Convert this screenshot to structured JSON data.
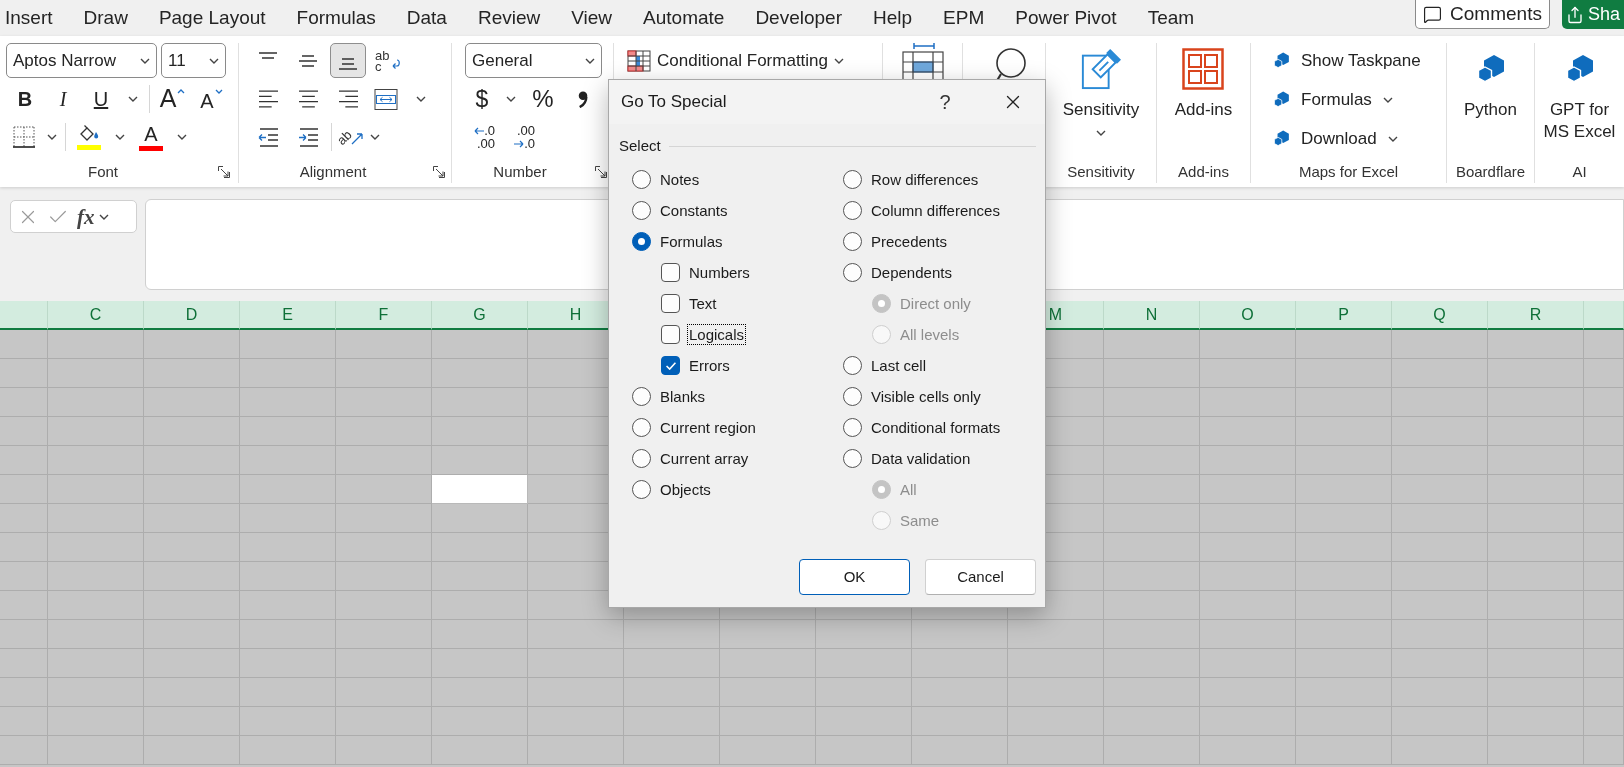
{
  "tabs": [
    "Insert",
    "Draw",
    "Page Layout",
    "Formulas",
    "Data",
    "Review",
    "View",
    "Automate",
    "Developer",
    "Help",
    "EPM",
    "Power Pivot",
    "Team"
  ],
  "header_buttons": [
    {
      "kind": "comments",
      "label": "Comments"
    },
    {
      "kind": "share",
      "label": "Sha"
    }
  ],
  "ribbon": {
    "font": {
      "label": "Font",
      "font_name": "Aptos Narrow",
      "font_size": "11",
      "style_buttons": [
        {
          "kind": "bold",
          "text": "B"
        },
        {
          "kind": "italic",
          "text": "I"
        },
        {
          "kind": "underline",
          "text": "U"
        }
      ],
      "size_buttons": [
        {
          "kind": "grow",
          "text": "A"
        },
        {
          "kind": "shrink",
          "text": "A"
        }
      ],
      "fill_color": {
        "color": "#ffff00"
      },
      "font_color": {
        "text": "A",
        "color": "#ff0000"
      }
    },
    "alignment": {
      "label": "Alignment",
      "vertical": [
        {
          "kind": "top",
          "selected": false
        },
        {
          "kind": "middle",
          "selected": false
        },
        {
          "kind": "bottom",
          "selected": true
        }
      ],
      "wrap_text": "ab c",
      "orientation": "ab"
    },
    "number": {
      "label": "Number",
      "format": "General",
      "currency": "$",
      "percent": "%",
      "increase_decimal": [
        ".0",
        ".00"
      ],
      "decrease_decimal": [
        ".00",
        ".0"
      ]
    },
    "styles": {
      "conditional_formatting": "Conditional Formatting"
    },
    "sensitivity": {
      "label": "Sensitivity",
      "button": "Sensitivity"
    },
    "add_ins": {
      "label": "Add-ins",
      "button": "Add-ins"
    },
    "maps": {
      "label": "Maps for Excel",
      "items": [
        {
          "label": "Show Taskpane",
          "dropdown": false
        },
        {
          "label": "Formulas",
          "dropdown": true
        },
        {
          "label": "Download",
          "dropdown": true
        }
      ]
    },
    "boardflare": {
      "label": "Boardflare",
      "button": "Python"
    },
    "ai": {
      "label": "AI",
      "button": "GPT for MS Excel"
    }
  },
  "formula_bar": {
    "function_label": "fx"
  },
  "sheet": {
    "all_selected": true,
    "columns_left": [
      {
        "label": "C",
        "selected": true,
        "active": false
      },
      {
        "label": "D",
        "selected": true,
        "active": false
      },
      {
        "label": "E",
        "selected": true,
        "active": false
      },
      {
        "label": "F",
        "selected": true,
        "active": false
      },
      {
        "label": "G",
        "selected": true,
        "active": true
      },
      {
        "label": "H",
        "selected": true,
        "active": false
      }
    ],
    "columns_right": [
      {
        "label": "M",
        "selected": true,
        "active": false
      },
      {
        "label": "N",
        "selected": true,
        "active": false
      },
      {
        "label": "O",
        "selected": true,
        "active": false
      },
      {
        "label": "P",
        "selected": true,
        "active": false
      },
      {
        "label": "Q",
        "selected": true,
        "active": false
      },
      {
        "label": "R",
        "selected": true,
        "active": false
      }
    ],
    "rows": [
      {
        "active": false
      },
      {
        "active": false
      },
      {
        "active": false
      },
      {
        "active": false
      },
      {
        "active": false
      },
      {
        "active": true
      },
      {
        "active": false
      },
      {
        "active": false
      },
      {
        "active": false
      },
      {
        "active": false
      },
      {
        "active": false
      },
      {
        "active": false
      },
      {
        "active": false
      },
      {
        "active": false
      },
      {
        "active": false
      }
    ]
  },
  "dialog": {
    "title": "Go To Special",
    "help": "?",
    "group_label": "Select",
    "left_options": [
      {
        "kind": "radio",
        "label": "Notes",
        "selected": false,
        "disabled": false,
        "focused": false
      },
      {
        "kind": "radio",
        "label": "Constants",
        "selected": false,
        "disabled": false,
        "focused": false
      },
      {
        "kind": "radio",
        "label": "Formulas",
        "selected": true,
        "disabled": false,
        "focused": false,
        "children": [
          {
            "kind": "checkbox",
            "label": "Numbers",
            "checked": false,
            "disabled": false,
            "focused": false
          },
          {
            "kind": "checkbox",
            "label": "Text",
            "checked": false,
            "disabled": false,
            "focused": false
          },
          {
            "kind": "checkbox",
            "label": "Logicals",
            "checked": false,
            "disabled": false,
            "focused": true
          },
          {
            "kind": "checkbox",
            "label": "Errors",
            "checked": true,
            "disabled": false,
            "focused": false
          }
        ]
      },
      {
        "kind": "radio",
        "label": "Blanks",
        "selected": false,
        "disabled": false,
        "focused": false
      },
      {
        "kind": "radio",
        "label": "Current region",
        "selected": false,
        "disabled": false,
        "focused": false
      },
      {
        "kind": "radio",
        "label": "Current array",
        "selected": false,
        "disabled": false,
        "focused": false
      },
      {
        "kind": "radio",
        "label": "Objects",
        "selected": false,
        "disabled": false,
        "focused": false
      }
    ],
    "right_options": [
      {
        "kind": "radio",
        "label": "Row differences",
        "selected": false,
        "disabled": false,
        "focused": false
      },
      {
        "kind": "radio",
        "label": "Column differences",
        "selected": false,
        "disabled": false,
        "focused": false
      },
      {
        "kind": "radio",
        "label": "Precedents",
        "selected": false,
        "disabled": false,
        "focused": false
      },
      {
        "kind": "radio",
        "label": "Dependents",
        "selected": false,
        "disabled": false,
        "focused": false,
        "children": [
          {
            "kind": "radio",
            "label": "Direct only",
            "selected": true,
            "disabled": true,
            "focused": false
          },
          {
            "kind": "radio",
            "label": "All levels",
            "selected": false,
            "disabled": true,
            "focused": false
          }
        ]
      },
      {
        "kind": "radio",
        "label": "Last cell",
        "selected": false,
        "disabled": false,
        "focused": false
      },
      {
        "kind": "radio",
        "label": "Visible cells only",
        "selected": false,
        "disabled": false,
        "focused": false
      },
      {
        "kind": "radio",
        "label": "Conditional formats",
        "selected": false,
        "disabled": false,
        "focused": false
      },
      {
        "kind": "radio",
        "label": "Data validation",
        "selected": false,
        "disabled": false,
        "focused": false,
        "children": [
          {
            "kind": "radio",
            "label": "All",
            "selected": true,
            "disabled": true,
            "focused": false
          },
          {
            "kind": "radio",
            "label": "Same",
            "selected": false,
            "disabled": true,
            "focused": false
          }
        ]
      }
    ],
    "buttons": [
      {
        "label": "OK",
        "default": true
      },
      {
        "label": "Cancel",
        "default": false
      }
    ]
  }
}
